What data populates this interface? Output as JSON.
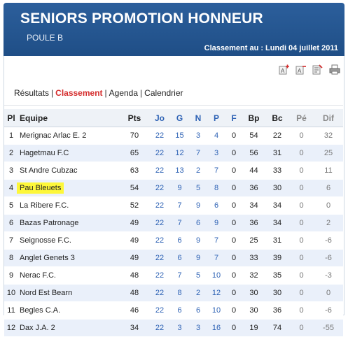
{
  "header": {
    "title": "SENIORS PROMOTION HONNEUR",
    "subtitle": "POULE B",
    "date": "Classement au : Lundi 04 juillet 2011"
  },
  "nav": {
    "items": [
      "Résultats",
      "Classement",
      "Agenda",
      "Calendrier"
    ],
    "separator": "|"
  },
  "icons": [
    "text-size-increase-icon",
    "text-size-decrease-icon",
    "document-icon",
    "print-icon"
  ],
  "table": {
    "headers": [
      "Pl",
      "Equipe",
      "Pts",
      "Jo",
      "G",
      "N",
      "P",
      "F",
      "Bp",
      "Bc",
      "Pé",
      "Dif"
    ],
    "rows": [
      [
        "1",
        "Merignac Arlac E. 2",
        "70",
        "22",
        "15",
        "3",
        "4",
        "0",
        "54",
        "22",
        "0",
        "32"
      ],
      [
        "2",
        "Hagetmau F.C",
        "65",
        "22",
        "12",
        "7",
        "3",
        "0",
        "56",
        "31",
        "0",
        "25"
      ],
      [
        "3",
        "St Andre Cubzac",
        "63",
        "22",
        "13",
        "2",
        "7",
        "0",
        "44",
        "33",
        "0",
        "11"
      ],
      [
        "4",
        "Pau Bleuets",
        "54",
        "22",
        "9",
        "5",
        "8",
        "0",
        "36",
        "30",
        "0",
        "6"
      ],
      [
        "5",
        "La Ribere F.C.",
        "52",
        "22",
        "7",
        "9",
        "6",
        "0",
        "34",
        "34",
        "0",
        "0"
      ],
      [
        "6",
        "Bazas Patronage",
        "49",
        "22",
        "7",
        "6",
        "9",
        "0",
        "36",
        "34",
        "0",
        "2"
      ],
      [
        "7",
        "Seignosse F.C.",
        "49",
        "22",
        "6",
        "9",
        "7",
        "0",
        "25",
        "31",
        "0",
        "-6"
      ],
      [
        "8",
        "Anglet Genets 3",
        "49",
        "22",
        "6",
        "9",
        "7",
        "0",
        "33",
        "39",
        "0",
        "-6"
      ],
      [
        "9",
        "Nerac F.C.",
        "48",
        "22",
        "7",
        "5",
        "10",
        "0",
        "32",
        "35",
        "0",
        "-3"
      ],
      [
        "10",
        "Nord Est Bearn",
        "48",
        "22",
        "8",
        "2",
        "12",
        "0",
        "30",
        "30",
        "0",
        "0"
      ],
      [
        "11",
        "Begles C.A.",
        "46",
        "22",
        "6",
        "6",
        "10",
        "0",
        "30",
        "36",
        "0",
        "-6"
      ],
      [
        "12",
        "Dax J.A. 2",
        "34",
        "22",
        "3",
        "3",
        "16",
        "0",
        "19",
        "74",
        "0",
        "-55"
      ]
    ],
    "highlight_row_index": 3
  },
  "colors": {
    "banner": "#2c5f9c",
    "accent_blue": "#2f63b5",
    "active_red": "#d42b2b",
    "even_row": "#eaf0fa",
    "highlight": "#fdf73a"
  }
}
